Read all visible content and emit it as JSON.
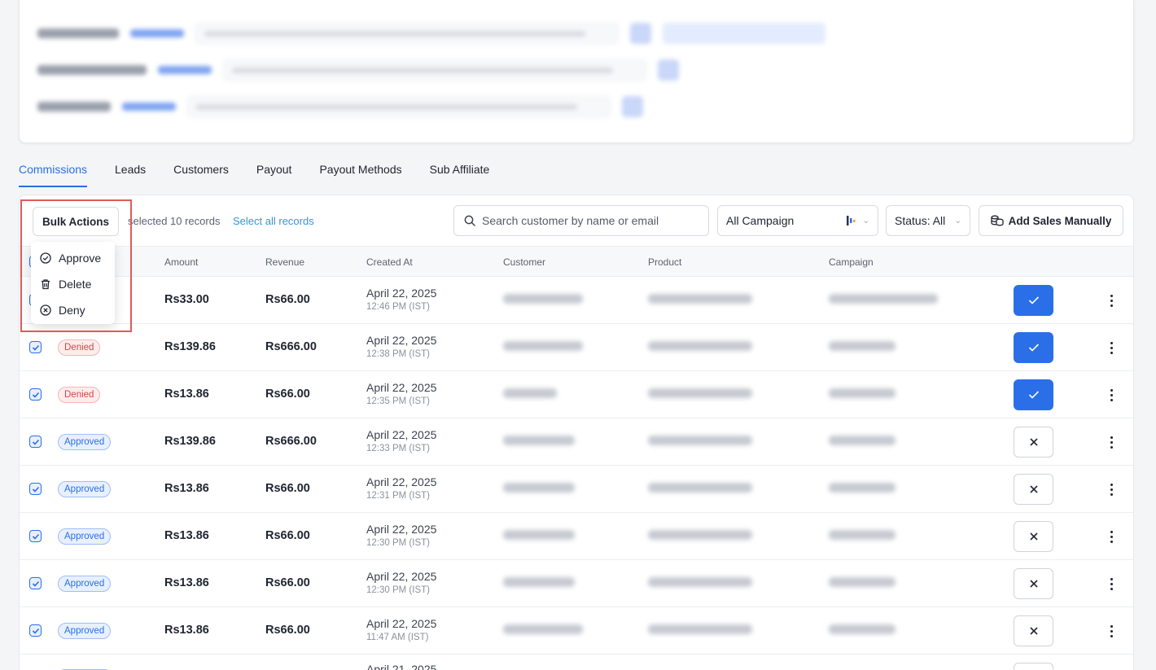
{
  "tabs": [
    "Commissions",
    "Leads",
    "Customers",
    "Payout",
    "Payout Methods",
    "Sub Affiliate"
  ],
  "toolbar": {
    "bulk_actions": "Bulk Actions",
    "selected_text": "selected 10 records",
    "select_all": "Select all records",
    "search_placeholder": "Search customer by name or email",
    "campaign": "All Campaign",
    "status": "Status: All",
    "add_sales": "Add Sales Manually"
  },
  "menu": {
    "approve": "Approve",
    "delete": "Delete",
    "deny": "Deny"
  },
  "table": {
    "headers": {
      "amount": "Amount",
      "revenue": "Revenue",
      "created_at": "Created At",
      "customer": "Customer",
      "product": "Product",
      "campaign": "Campaign"
    },
    "rows": [
      {
        "status": "",
        "amount": "Rs33.00",
        "revenue": "Rs66.00",
        "date": "April 22, 2025",
        "time": "12:46 PM (IST)",
        "action": "check"
      },
      {
        "status": "Denied",
        "amount": "Rs139.86",
        "revenue": "Rs666.00",
        "date": "April 22, 2025",
        "time": "12:38 PM (IST)",
        "action": "check"
      },
      {
        "status": "Denied",
        "amount": "Rs13.86",
        "revenue": "Rs66.00",
        "date": "April 22, 2025",
        "time": "12:35 PM (IST)",
        "action": "check"
      },
      {
        "status": "Approved",
        "amount": "Rs139.86",
        "revenue": "Rs666.00",
        "date": "April 22, 2025",
        "time": "12:33 PM (IST)",
        "action": "deny"
      },
      {
        "status": "Approved",
        "amount": "Rs13.86",
        "revenue": "Rs66.00",
        "date": "April 22, 2025",
        "time": "12:31 PM (IST)",
        "action": "deny"
      },
      {
        "status": "Approved",
        "amount": "Rs13.86",
        "revenue": "Rs66.00",
        "date": "April 22, 2025",
        "time": "12:30 PM (IST)",
        "action": "deny"
      },
      {
        "status": "Approved",
        "amount": "Rs13.86",
        "revenue": "Rs66.00",
        "date": "April 22, 2025",
        "time": "12:30 PM (IST)",
        "action": "deny"
      },
      {
        "status": "Approved",
        "amount": "Rs13.86",
        "revenue": "Rs66.00",
        "date": "April 22, 2025",
        "time": "11:47 AM (IST)",
        "action": "deny"
      }
    ],
    "partial_row_date": "April 21, 2025"
  },
  "colors": {
    "accent": "#2a6fe8",
    "denied": "#d64545",
    "highlight": "#e05a5a"
  }
}
